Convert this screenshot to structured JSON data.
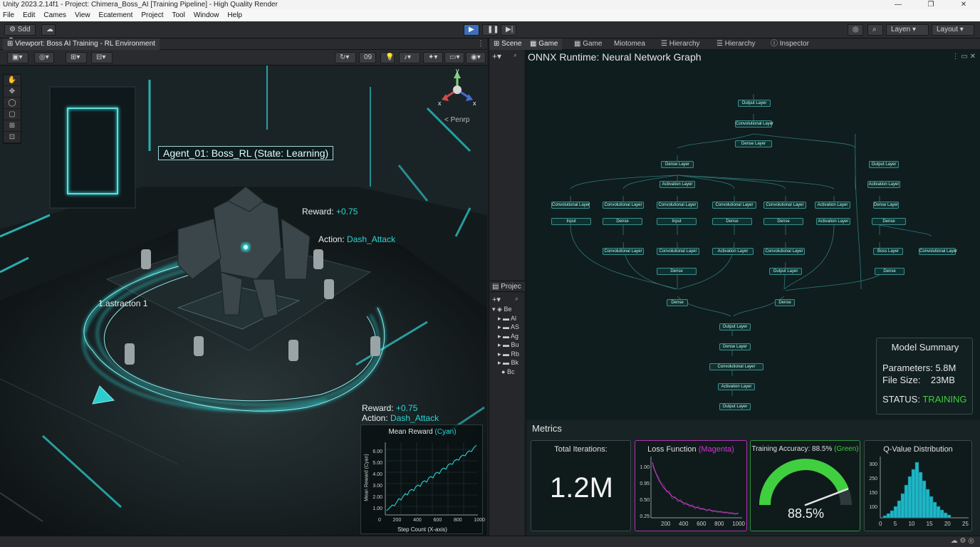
{
  "titlebar": {
    "title": "Unity 2023.2.14f1 - Project: Chimera_Boss_AI [Training Pipeline] - High Quality Render",
    "buttons": [
      "—",
      "❐",
      "✕"
    ]
  },
  "menu": [
    "File",
    "Edit",
    "Cames",
    "View",
    "Ecatement",
    "Project",
    "Tool",
    "Window",
    "Help"
  ],
  "toolbar": {
    "account": "Sdd",
    "layers": "Layen",
    "layout": "Layout"
  },
  "viewport": {
    "tab": "Viewport: Boss AI Training - RL Environment",
    "persp": "< Penrp",
    "gizmo_y": "y",
    "gizmo_x1": "x",
    "gizmo_x2": "x",
    "agent_label": "Agent_01: Boss_RL (State: Learning)",
    "reward_prefix": "Reward:",
    "reward_value": "+0.75",
    "action_prefix": "Action:",
    "action_value": "Dash_Attack",
    "distractor": "1.astracton 1",
    "tools": [
      "✋",
      "✥",
      "◯",
      "▢",
      "⊞",
      "⊡"
    ],
    "toolbar_count": "09"
  },
  "mini_chart": {
    "reward_prefix": "Reward:",
    "reward_value": "+0.75",
    "action_prefix": "Action:",
    "action_value": "Dash_Attack",
    "title_prefix": "Mean Reward",
    "title_suffix": "(Cyan)",
    "ylabel": "Mean Reward (Cyan)",
    "xlabel": "Step Count (X-axis)",
    "yticks": [
      "6.00",
      "5.00",
      "4.00",
      "3.00",
      "2.00",
      "1.00"
    ],
    "xticks": [
      "0",
      "200",
      "400",
      "600",
      "800",
      "1000"
    ]
  },
  "midcol": {
    "scene_tab": "Scene",
    "project_tab": "Projec",
    "tree": [
      "Be",
      "Al",
      "AS",
      "Ag",
      "Bu",
      "Rb",
      "Bk",
      "Bc"
    ]
  },
  "right_tabs": [
    "Game",
    "Game",
    "Miotomea",
    "Hierarchy",
    "Hierarchy",
    "Inspector"
  ],
  "onnx": {
    "title": "ONNX Runtime: Neural Network Graph",
    "nodes": [
      "Output Layer",
      "Convolutional Layer",
      "Dense Layer",
      "Dense Layer",
      "Output Layer",
      "Activation Layer",
      "Activation Layer",
      "Convolutional Layer",
      "Convolutional Layer",
      "Convolutional Layer",
      "Convolutional Layer",
      "Convolutional Layer",
      "Activation Layer",
      "Dense Layer",
      "Input",
      "Dense",
      "Input",
      "Dense",
      "Dense",
      "Activation Layer",
      "Dense",
      "Convolutional Layer",
      "Convolutional Layer",
      "Activation Layer",
      "Convolutional Layer",
      "Boss Layer",
      "Convolutional Layer",
      "Dense",
      "Output Layer",
      "Dense",
      "Dense",
      "Dense",
      "Output Layer",
      "Dense Layer",
      "Convolutional Layer",
      "Activation Layer",
      "Output Layer"
    ]
  },
  "summary": {
    "title": "Model Summary",
    "params_label": "Parameters:",
    "params_value": "5.8M",
    "size_label": "File Size:",
    "size_value": "23MB",
    "status_label": "STATUS:",
    "status_value": "TRAINING"
  },
  "metrics": {
    "header": "Metrics",
    "iterations_title": "Total Iterations:",
    "iterations_value": "1.2M",
    "loss_title_prefix": "Loss Function",
    "loss_title_suffix": "(Magenta)",
    "loss_yticks": [
      "1.00",
      "0.95",
      "0.50",
      "0.25"
    ],
    "loss_xticks": [
      "200",
      "400",
      "600",
      "800",
      "1000"
    ],
    "acc_title_prefix": "Training Accuracy: 88.5%",
    "acc_title_suffix": "(Green)",
    "acc_value": "88.5%",
    "acc_fraction": 0.885,
    "qdist_title": "Q-Value Distribution",
    "qdist_yticks": [
      "300",
      "250",
      "150",
      "100",
      "50"
    ],
    "qdist_xticks": [
      "0",
      "5",
      "10",
      "15",
      "20",
      "25"
    ]
  },
  "colors": {
    "cyan": "#29d6d6",
    "magenta": "#d633d6",
    "green": "#3fcf3f",
    "teal": "#3a8f8f"
  }
}
